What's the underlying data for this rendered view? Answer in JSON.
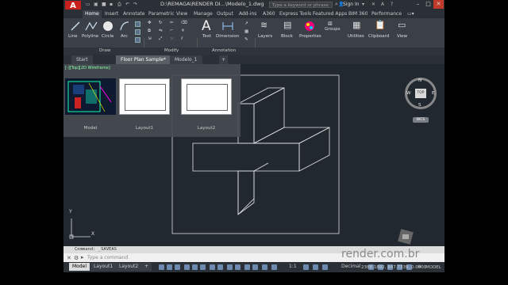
{
  "app": {
    "logo": "A",
    "title": "D:\\REMAGA\\RENDER DI...\\Modelo_1.dwg",
    "search_placeholder": "Type a keyword or phrase",
    "signin": "Sign In"
  },
  "ribbon_tabs": [
    "Home",
    "Insert",
    "Annotate",
    "Parametric",
    "View",
    "Manage",
    "Output",
    "Add-ins",
    "A360",
    "Express Tools",
    "Featured Apps",
    "BIM 360",
    "Performance"
  ],
  "ribbon": {
    "draw_tools": [
      "Line",
      "Polyline",
      "Circle",
      "Arc"
    ],
    "text_tool": "Text",
    "dimension_tool": "Dimension",
    "layers_tool": "Layers",
    "block_tool": "Block",
    "properties_tool": "Properties",
    "groups_tool": "Groups",
    "utilities_tool": "Utilities",
    "clipboard_tool": "Clipboard",
    "view_tool": "View",
    "panels": [
      "Draw",
      "Modify",
      "Annotation"
    ]
  },
  "doc_tabs": [
    "Start",
    "Floor Plan Sample*",
    "Modelo_1"
  ],
  "viewport_label": "[-][Top][2D Wireframe]",
  "thumbnails": [
    "Model",
    "Layout1",
    "Layout2"
  ],
  "viewcube": {
    "north": "N",
    "south": "S",
    "east": "E",
    "west": "W",
    "face": "TOP",
    "wcs": "WCS"
  },
  "ucs": {
    "x": "X",
    "y": "Y"
  },
  "command": {
    "history": "Command:  _SAVEAS",
    "placeholder": "Type a command"
  },
  "layout_tabs": [
    "Model",
    "Layout1",
    "Layout2"
  ],
  "status": {
    "coords": "2388.1892, 847.7339, 0.0000",
    "scale": "1:1",
    "units": "Decimal",
    "mode": "MODEL"
  },
  "watermark": "render.com.br",
  "colors": {
    "accent": "#c8201c",
    "canvas": "#212830",
    "ribbon": "#3b4048"
  }
}
